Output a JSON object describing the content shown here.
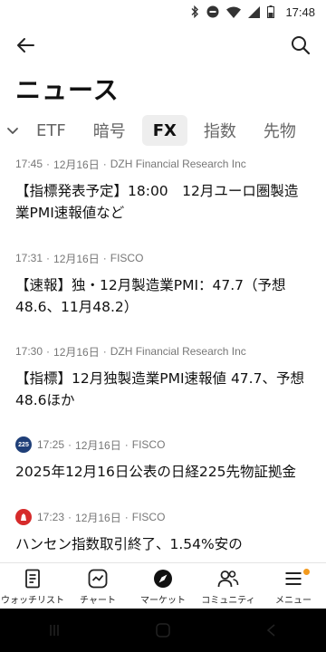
{
  "status_bar": {
    "time": "17:48",
    "icons": [
      "bluetooth-icon",
      "dnd-icon",
      "wifi-icon",
      "signal-icon",
      "battery-icon"
    ]
  },
  "header": {
    "back_icon": "back-arrow-icon",
    "search_icon": "search-icon",
    "title": "ニュース"
  },
  "tabs": [
    {
      "label": "ETF",
      "active": false
    },
    {
      "label": "暗号",
      "active": false
    },
    {
      "label": "FX",
      "active": true
    },
    {
      "label": "指数",
      "active": false
    },
    {
      "label": "先物",
      "active": false
    }
  ],
  "news": [
    {
      "time": "17:45",
      "date": "12月16日",
      "source": "DZH Financial Research Inc",
      "logo": "",
      "headline": "【指標発表予定】18:00　12月ユーロ圏製造業PMI速報値など"
    },
    {
      "time": "17:31",
      "date": "12月16日",
      "source": "FISCO",
      "logo": "",
      "headline": "【速報】独・12月製造業PMI：47.7（予想48.6、11月48.2）"
    },
    {
      "time": "17:30",
      "date": "12月16日",
      "source": "DZH Financial Research Inc",
      "logo": "",
      "headline": "【指標】12月独製造業PMI速報値 47.7、予想48.6ほか"
    },
    {
      "time": "17:25",
      "date": "12月16日",
      "source": "FISCO",
      "logo": "225",
      "headline": "2025年12月16日公表の日経225先物証拠金"
    },
    {
      "time": "17:23",
      "date": "12月16日",
      "source": "FISCO",
      "logo": "",
      "headline": "ハンセン指数取引終了、1.54%安の"
    }
  ],
  "bottom_nav": [
    {
      "label": "ウォッチリスト",
      "icon": "watchlist-icon",
      "badge": false
    },
    {
      "label": "チャート",
      "icon": "chart-icon",
      "badge": false
    },
    {
      "label": "マーケット",
      "icon": "compass-icon",
      "badge": false
    },
    {
      "label": "コミュニティ",
      "icon": "community-icon",
      "badge": false
    },
    {
      "label": "メニュー",
      "icon": "menu-icon",
      "badge": true
    }
  ],
  "colors": {
    "badge": "#f39a1e",
    "active_tab_bg": "#eeeeee",
    "logo_225": "#1f3f78",
    "logo_red": "#d62b2b"
  }
}
